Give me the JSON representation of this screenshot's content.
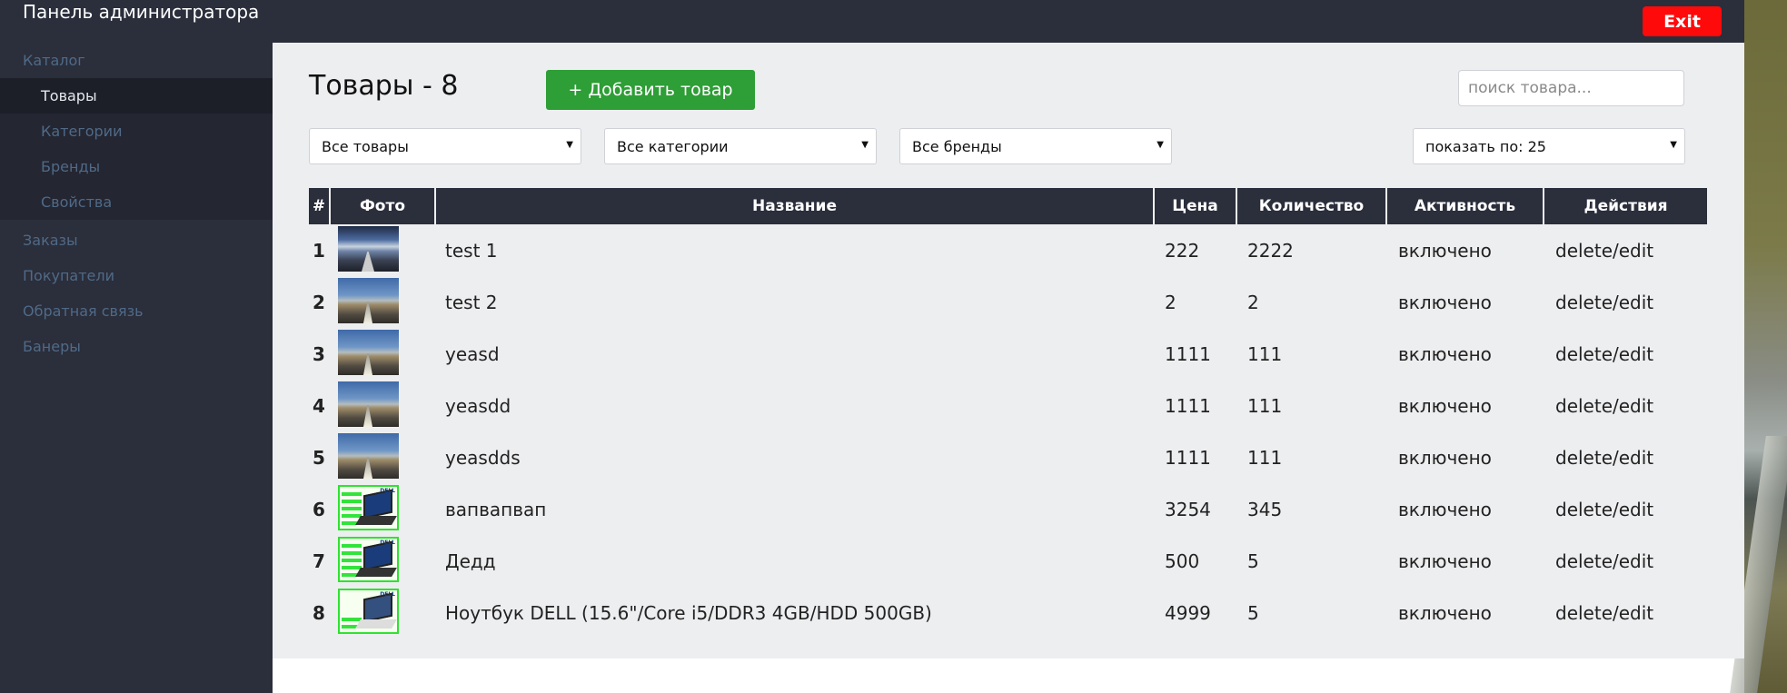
{
  "header": {
    "title": "Панель администратора",
    "exit_label": "Exit"
  },
  "sidebar": {
    "items": [
      {
        "label": "Каталог"
      },
      {
        "label": "Товары",
        "active": true
      },
      {
        "label": "Категории"
      },
      {
        "label": "Бренды"
      },
      {
        "label": "Свойства"
      },
      {
        "label": "Заказы"
      },
      {
        "label": "Покупатели"
      },
      {
        "label": "Обратная связь"
      },
      {
        "label": "Банеры"
      }
    ]
  },
  "main": {
    "title": "Товары - 8",
    "add_button": "+ Добавить товар",
    "search": {
      "placeholder": "поиск товара...",
      "value": ""
    },
    "filters": {
      "products": "Все товары",
      "categories": "Все категории",
      "brands": "Все бренды",
      "per_page": "показать по: 25"
    },
    "table": {
      "columns": [
        "#",
        "Фото",
        "Название",
        "Цена",
        "Количество",
        "Активность",
        "Действия"
      ],
      "rows": [
        {
          "num": "1",
          "photo": "storm-road",
          "name": "test 1",
          "price": "222",
          "qty": "2222",
          "status": "включено",
          "actions": "delete/edit"
        },
        {
          "num": "2",
          "photo": "road",
          "name": "test 2",
          "price": "2",
          "qty": "2",
          "status": "включено",
          "actions": "delete/edit"
        },
        {
          "num": "3",
          "photo": "road",
          "name": "yeasd",
          "price": "1111",
          "qty": "111",
          "status": "включено",
          "actions": "delete/edit"
        },
        {
          "num": "4",
          "photo": "road",
          "name": "yeasdd",
          "price": "1111",
          "qty": "111",
          "status": "включено",
          "actions": "delete/edit"
        },
        {
          "num": "5",
          "photo": "road",
          "name": "yeasdds",
          "price": "1111",
          "qty": "111",
          "status": "включено",
          "actions": "delete/edit"
        },
        {
          "num": "6",
          "photo": "dell-laptop",
          "name": "вапвапвап",
          "price": "3254",
          "qty": "345",
          "status": "включено",
          "actions": "delete/edit"
        },
        {
          "num": "7",
          "photo": "dell-laptop",
          "name": "Дедд",
          "price": "500",
          "qty": "5",
          "status": "включено",
          "actions": "delete/edit"
        },
        {
          "num": "8",
          "photo": "dell-laptop-white",
          "name": "Ноутбук DELL (15.6\"/Core i5/DDR3 4GB/HDD 500GB)",
          "price": "4999",
          "qty": "5",
          "status": "включено",
          "actions": "delete/edit"
        }
      ]
    }
  },
  "colors": {
    "nav_bg": "#2b2e3b",
    "exit_button": "#ff0a0a",
    "add_button": "#2e9e36",
    "content_bg": "#edeef0"
  }
}
